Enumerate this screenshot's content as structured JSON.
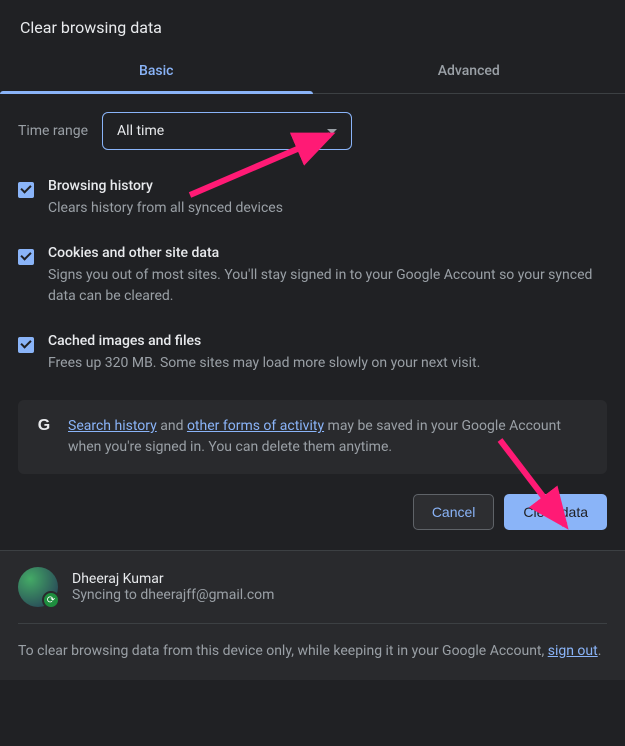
{
  "dialog": {
    "title": "Clear browsing data"
  },
  "tabs": {
    "basic": "Basic",
    "advanced": "Advanced"
  },
  "time_range": {
    "label": "Time range",
    "value": "All time"
  },
  "options": [
    {
      "title": "Browsing history",
      "desc": "Clears history from all synced devices",
      "checked": true
    },
    {
      "title": "Cookies and other site data",
      "desc": "Signs you out of most sites. You'll stay signed in to your Google Account so your synced data can be cleared.",
      "checked": true
    },
    {
      "title": "Cached images and files",
      "desc": "Frees up 320 MB. Some sites may load more slowly on your next visit.",
      "checked": true
    }
  ],
  "info": {
    "link1": "Search history",
    "mid1": " and ",
    "link2": "other forms of activity",
    "rest": " may be saved in your Google Account when you're signed in. You can delete them anytime."
  },
  "buttons": {
    "cancel": "Cancel",
    "clear": "Clear data"
  },
  "account": {
    "name": "Dheeraj Kumar",
    "sync_prefix": "Syncing to ",
    "email": "dheerajff@gmail.com"
  },
  "footer": {
    "text_before": "To clear browsing data from this device only, while keeping it in your Google Account, ",
    "signout": "sign out",
    "text_after": "."
  }
}
